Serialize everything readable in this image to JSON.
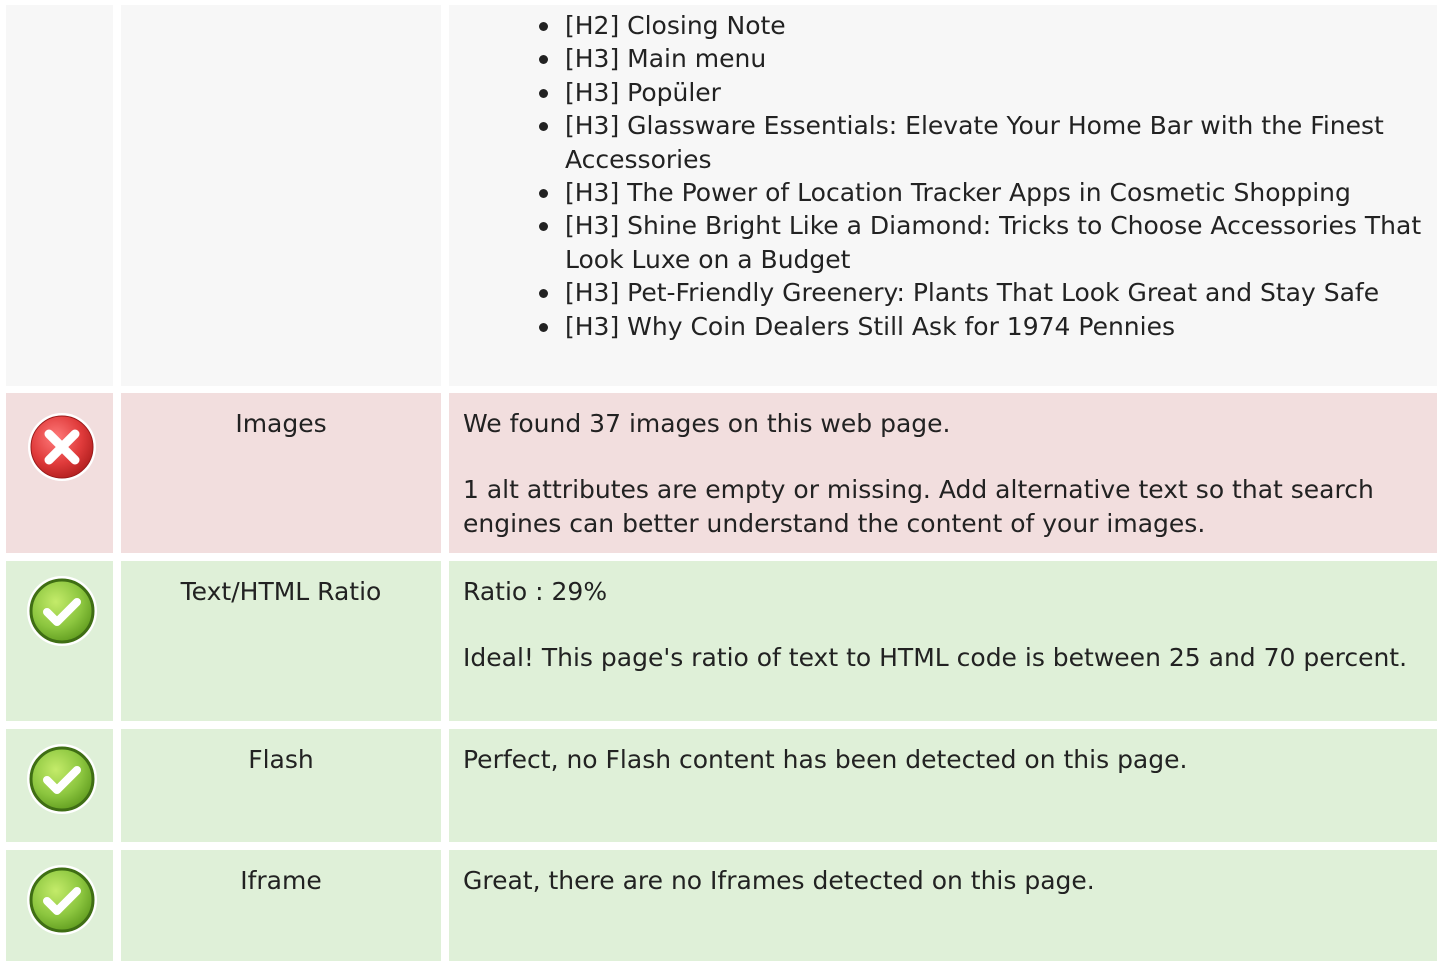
{
  "headings_row": {
    "items": [
      "[H2] Closing Note",
      "[H3] Main menu",
      "[H3] Popüler",
      "[H3] Glassware Essentials: Elevate Your Home Bar with the Finest Accessories",
      "[H3] The Power of Location Tracker Apps in Cosmetic Shopping",
      "[H3] Shine Bright Like a Diamond: Tricks to Choose Accessories That Look Luxe on a Budget",
      "[H3] Pet-Friendly Greenery: Plants That Look Great and Stay Safe",
      "[H3] Why Coin Dealers Still Ask for 1974 Pennies"
    ]
  },
  "rows": {
    "images": {
      "status": "fail",
      "icon": "error-x-icon",
      "name": "Images",
      "line1": "We found 37 images on this web page.",
      "line2": "1 alt attributes are empty or missing. Add alternative text so that search engines can better understand the content of your images."
    },
    "ratio": {
      "status": "pass",
      "icon": "check-icon",
      "name": "Text/HTML Ratio",
      "line1": "Ratio : 29%",
      "line2": "Ideal! This page's ratio of text to HTML code is between 25 and 70 percent."
    },
    "flash": {
      "status": "pass",
      "icon": "check-icon",
      "name": "Flash",
      "line1": "Perfect, no Flash content has been detected on this page."
    },
    "iframe": {
      "status": "pass",
      "icon": "check-icon",
      "name": "Iframe",
      "line1": "Great, there are no Iframes detected on this page."
    }
  },
  "colors": {
    "fail_bg": "#f2dede",
    "pass_bg": "#dff0d8",
    "neutral_bg": "#f7f7f7",
    "fail_icon": "#e03b3b",
    "pass_icon": "#8cc63f"
  }
}
